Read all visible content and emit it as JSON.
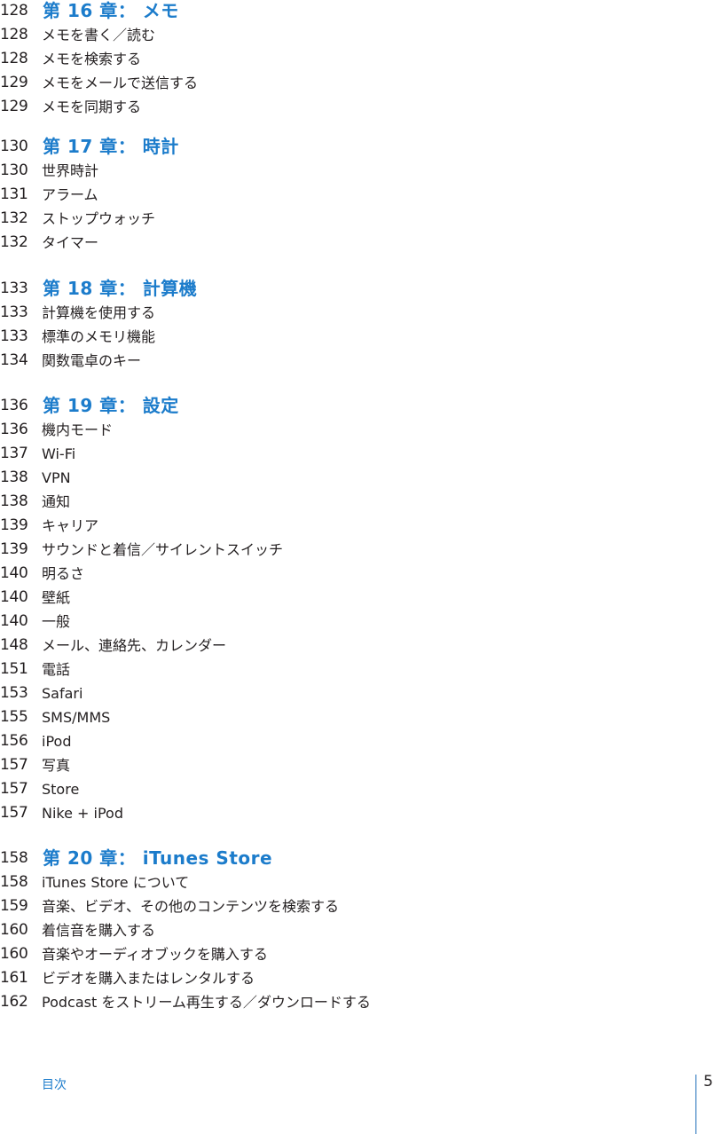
{
  "chapters": [
    {
      "page": "128",
      "title": "第 16 章： メモ",
      "entries": [
        {
          "page": "128",
          "title": "メモを書く／読む"
        },
        {
          "page": "128",
          "title": "メモを検索する"
        },
        {
          "page": "129",
          "title": "メモをメールで送信する"
        },
        {
          "page": "129",
          "title": "メモを同期する"
        }
      ]
    },
    {
      "page": "130",
      "title": "第 17 章： 時計",
      "entries": [
        {
          "page": "130",
          "title": "世界時計"
        },
        {
          "page": "131",
          "title": "アラーム"
        },
        {
          "page": "132",
          "title": "ストップウォッチ"
        },
        {
          "page": "132",
          "title": "タイマー"
        }
      ]
    },
    {
      "page": "133",
      "title": "第 18 章： 計算機",
      "entries": [
        {
          "page": "133",
          "title": "計算機を使用する"
        },
        {
          "page": "133",
          "title": "標準のメモリ機能"
        },
        {
          "page": "134",
          "title": "関数電卓のキー"
        }
      ]
    },
    {
      "page": "136",
      "title": "第 19 章： 設定",
      "entries": [
        {
          "page": "136",
          "title": "機内モード"
        },
        {
          "page": "137",
          "title": "Wi-Fi"
        },
        {
          "page": "138",
          "title": "VPN"
        },
        {
          "page": "138",
          "title": "通知"
        },
        {
          "page": "139",
          "title": "キャリア"
        },
        {
          "page": "139",
          "title": "サウンドと着信／サイレントスイッチ"
        },
        {
          "page": "140",
          "title": "明るさ"
        },
        {
          "page": "140",
          "title": "壁紙"
        },
        {
          "page": "140",
          "title": "一般"
        },
        {
          "page": "148",
          "title": "メール、連絡先、カレンダー"
        },
        {
          "page": "151",
          "title": "電話"
        },
        {
          "page": "153",
          "title": "Safari"
        },
        {
          "page": "155",
          "title": "SMS/MMS"
        },
        {
          "page": "156",
          "title": "iPod"
        },
        {
          "page": "157",
          "title": "写真"
        },
        {
          "page": "157",
          "title": "Store"
        },
        {
          "page": "157",
          "title": "Nike + iPod"
        }
      ]
    },
    {
      "page": "158",
      "title": "第 20 章： iTunes Store",
      "entries": [
        {
          "page": "158",
          "title": "iTunes Store について"
        },
        {
          "page": "159",
          "title": "音楽、ビデオ、その他のコンテンツを検索する"
        },
        {
          "page": "160",
          "title": "着信音を購入する"
        },
        {
          "page": "160",
          "title": "音楽やオーディオブックを購入する"
        },
        {
          "page": "161",
          "title": "ビデオを購入またはレンタルする"
        },
        {
          "page": "162",
          "title": "Podcast をストリーム再生する／ダウンロードする"
        }
      ]
    }
  ],
  "footer": {
    "section_label": "目次",
    "page_number": "5"
  },
  "colors": {
    "heading": "#1c7ccb",
    "body_text": "#231f20",
    "footer_rule": "#1c6db8"
  }
}
